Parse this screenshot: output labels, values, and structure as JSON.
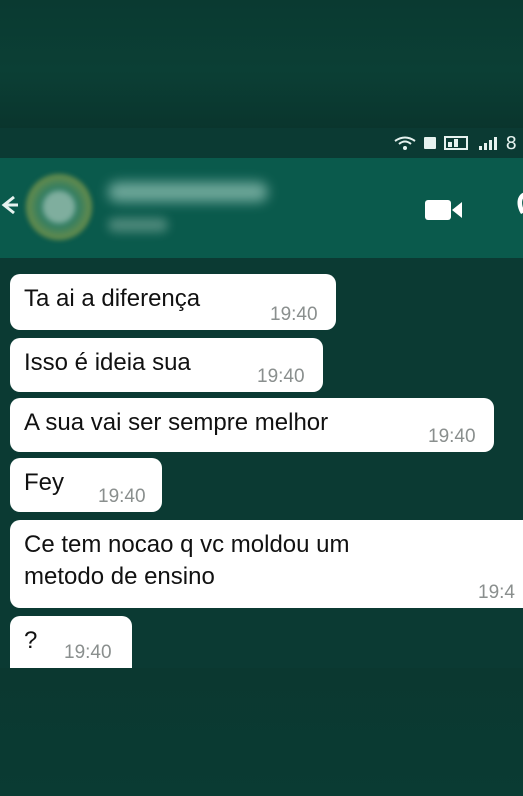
{
  "status_bar": {
    "right_value": "8"
  },
  "header": {
    "contact_name": "",
    "contact_status": ""
  },
  "messages": [
    {
      "text": "Ta ai a diferença",
      "time": "19:40"
    },
    {
      "text": "Isso é ideia sua",
      "time": "19:40"
    },
    {
      "text": "A sua vai ser sempre melhor",
      "time": "19:40"
    },
    {
      "text": "Fey",
      "time": "19:40"
    },
    {
      "text_line1": "Ce tem nocao q vc moldou um",
      "text_line2": "metodo de ensino",
      "time": "19:4"
    },
    {
      "text": "?",
      "time": "19:40"
    }
  ],
  "colors": {
    "header_bg": "#0a5a4c",
    "chat_bg": "#0b3a33",
    "bubble_bg": "#ffffff"
  }
}
